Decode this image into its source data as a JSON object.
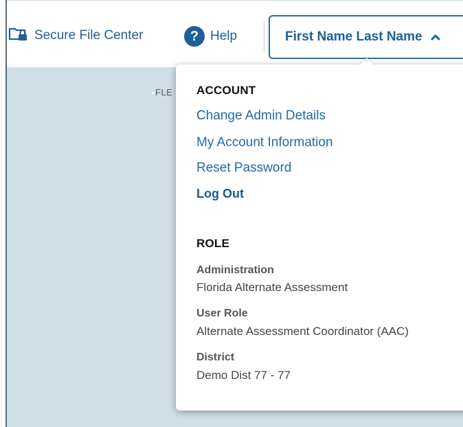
{
  "header": {
    "secure_file_center": "Secure File Center",
    "help": "Help",
    "user_name": "First Name Last Name"
  },
  "background": {
    "label": "FLE"
  },
  "dropdown": {
    "account": {
      "title": "ACCOUNT",
      "links": [
        "Change Admin Details",
        "My Account Information",
        "Reset Password"
      ],
      "logout": "Log Out"
    },
    "role": {
      "title": "ROLE",
      "fields": [
        {
          "label": "Administration",
          "value": "Florida Alternate Assessment"
        },
        {
          "label": "User Role",
          "value": "Alternate Assessment Coordinator (AAC)"
        },
        {
          "label": "District",
          "value": "Demo Dist 77 - 77"
        }
      ]
    }
  },
  "colors": {
    "brand_blue": "#1d5f98",
    "link_blue": "#1e6aa6",
    "content_bg": "#cfdfe6"
  },
  "icons": {
    "secure": "folder-lock-icon",
    "help": "question-circle-icon",
    "chevron": "chevron-up-icon"
  }
}
